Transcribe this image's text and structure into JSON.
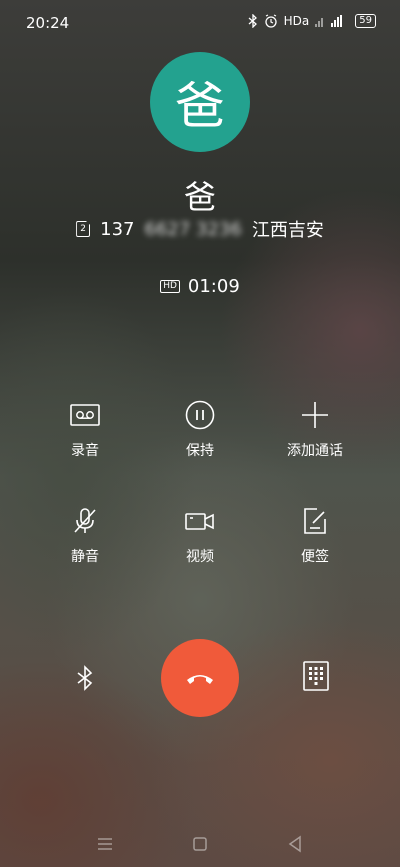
{
  "status_bar": {
    "time": "20:24",
    "network": "HDa",
    "battery": "59",
    "icons": [
      "bluetooth-icon",
      "alarm-icon",
      "signal-icon",
      "battery-icon"
    ]
  },
  "call": {
    "avatar_text": "爸",
    "avatar_color": "#23a28f",
    "name": "爸",
    "sim": "2",
    "number_prefix": "137",
    "number_masked": "6627 3236",
    "location": "江西吉安",
    "hd_label": "HD",
    "duration": "01:09"
  },
  "controls": [
    {
      "label": "录音",
      "icon": "record-icon"
    },
    {
      "label": "保持",
      "icon": "pause-icon"
    },
    {
      "label": "添加通话",
      "icon": "plus-icon"
    },
    {
      "label": "静音",
      "icon": "mute-mic-icon"
    },
    {
      "label": "视频",
      "icon": "video-icon"
    },
    {
      "label": "便签",
      "icon": "note-icon"
    }
  ],
  "bottom": {
    "left_icon": "bluetooth-icon",
    "end_call_icon": "hang-up-icon",
    "end_call_color": "#f05a3a",
    "right_icon": "dialpad-icon"
  },
  "nav": [
    "menu-icon",
    "home-icon",
    "back-icon"
  ]
}
